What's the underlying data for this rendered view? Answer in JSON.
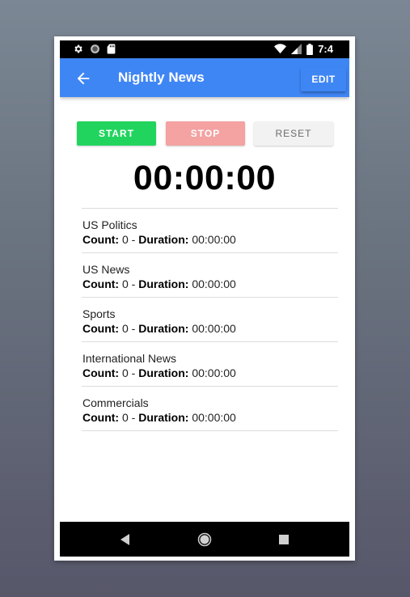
{
  "status_bar": {
    "time": "7:4",
    "icons": [
      "settings-icon",
      "record-icon",
      "sd-card-icon",
      "wifi-icon",
      "signal-icon",
      "battery-icon"
    ]
  },
  "app_bar": {
    "title": "Nightly News",
    "edit_label": "EDIT",
    "back_icon": "arrow-left-icon",
    "color": "#3f86f5"
  },
  "controls": {
    "start_label": "START",
    "stop_label": "STOP",
    "reset_label": "RESET",
    "start_color": "#21d45e",
    "stop_color": "#f4a2a2",
    "reset_color": "#f2f2f2"
  },
  "timer": {
    "display": "00:00:00"
  },
  "segments": [
    {
      "name": "US Politics",
      "count_label": "Count:",
      "count": " 0 - ",
      "duration_label": "Duration:",
      "duration": " 00:00:00"
    },
    {
      "name": "US News",
      "count_label": "Count:",
      "count": " 0 - ",
      "duration_label": "Duration:",
      "duration": " 00:00:00"
    },
    {
      "name": "Sports",
      "count_label": "Count:",
      "count": " 0 - ",
      "duration_label": "Duration:",
      "duration": " 00:00:00"
    },
    {
      "name": "International News",
      "count_label": "Count:",
      "count": " 0 - ",
      "duration_label": "Duration:",
      "duration": " 00:00:00"
    },
    {
      "name": "Commercials",
      "count_label": "Count:",
      "count": " 0 - ",
      "duration_label": "Duration:",
      "duration": " 00:00:00"
    }
  ],
  "nav_bar": {
    "icons": [
      "back-triangle-icon",
      "home-circle-icon",
      "recents-square-icon"
    ]
  }
}
